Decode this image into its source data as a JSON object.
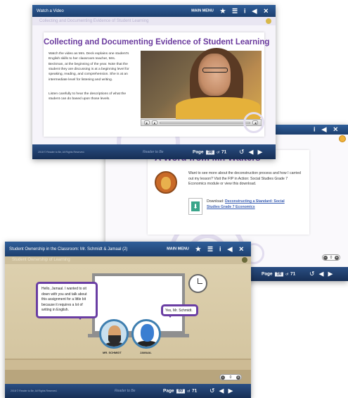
{
  "window_middle": {
    "title": "A Word from Mr. Walters",
    "body_text": "Want to see more about the deconstruction process and how I carried out my lesson? Visit the FIP in Action: Social Studies Grade 7 Economics module or view this download.",
    "download_prefix": "Download:",
    "download_link": "Deconstructing a Standard: Social Studies Grade 7 Economics",
    "page_label": "Page",
    "page_number": "16",
    "page_of": "of",
    "page_total": "71",
    "zoom_label": "0"
  },
  "window_top": {
    "window_title": "Watch a Video",
    "menu_label": "MAIN MENU",
    "section_title": "Collecting and Documenting Evidence of Student Learning",
    "heading": "Collecting and Documenting Evidence of Student Learning",
    "paragraph_1": "Watch the video as Mrs. Deck explains one student's English skills to her classroom teacher, Mrs. Beckman, at the beginning of the year. Note that the student they are discussing is at a beginning level for speaking, reading, and comprehension. She is at an intermediate level for listening and writing.",
    "paragraph_2": "Listen carefully to hear the descriptions of what the student can do based upon those levels.",
    "copyright": "2018 © Reader to Be, All Rights Reserved.",
    "brand": "Reader to Be",
    "page_label": "Page",
    "page_number": "38",
    "page_of": "of",
    "page_total": "71"
  },
  "window_bottom": {
    "window_title": "Student Ownership in the Classroom: Mr. Schmidt & Jamaal (2)",
    "menu_label": "MAIN MENU",
    "section_title": "Student Ownership of Learning",
    "bubble_teacher": "Hello, Jamaal. I wanted to sit down with you and talk about this assignment for a little bit because it requires a lot of writing in English.",
    "bubble_student": "Yes, Mr. Schmidt.",
    "name_teacher": "MR. SCHMIDT",
    "name_student": "JAMAAL",
    "copyright": "2018 © Reader to Be, All Rights Reserved.",
    "brand": "Reader to Be",
    "page_label": "Page",
    "page_number": "60",
    "page_of": "of",
    "page_total": "71",
    "zoom_label": "0"
  },
  "icons": {
    "star": "★",
    "menu": "☰",
    "info": "i",
    "sound": "◀",
    "close": "✕",
    "undo": "↺",
    "prev": "◀",
    "next": "▶"
  }
}
